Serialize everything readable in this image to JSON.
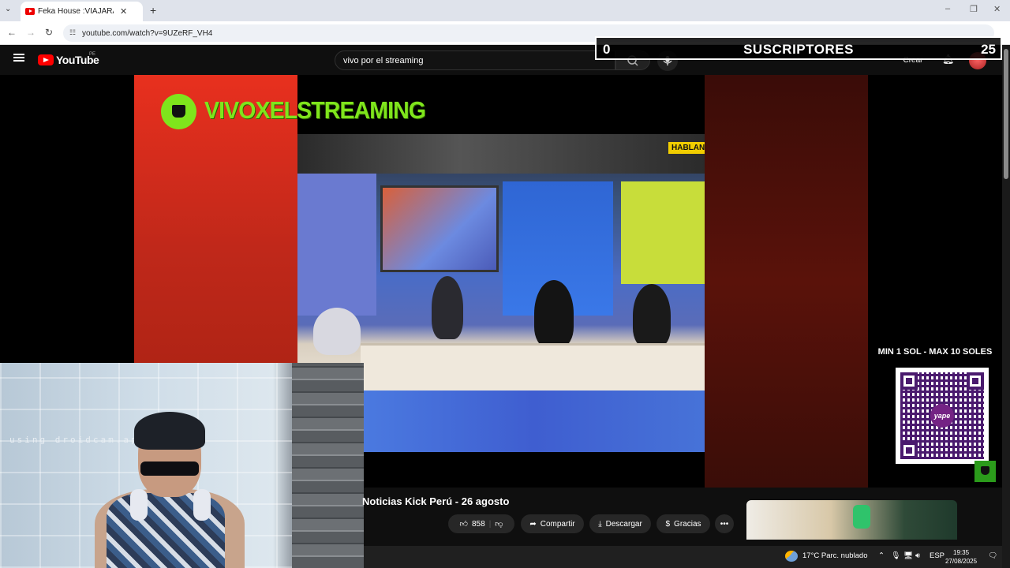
{
  "browser": {
    "tab_title": "Feka House :VIAJARÁ a",
    "url": "youtube.com/watch?v=9UZeRF_VH4",
    "new_tab_symbol": "+",
    "close_symbol": "✕",
    "menu_symbol": "⌄",
    "min_symbol": "–",
    "max_symbol": "❐",
    "winclose_symbol": "✕"
  },
  "youtube": {
    "wordmark": "YouTube",
    "country": "PE",
    "search_value": "vivo por el streaming",
    "create_label": "Crear"
  },
  "overlay": {
    "sub_left": "0",
    "sub_label": "SUSCRIPTORES",
    "sub_right": "25",
    "channel_name": "VIVOXELSTREAMING",
    "donation_label": "MIN 1 SOL - MAX 10 SOLES",
    "yape_text": "yape",
    "studio_sign": "HABLAN"
  },
  "webcam": {
    "watermark": "using droidcam.app"
  },
  "video": {
    "title": "Noticias Kick Perú - 26 agosto",
    "likes": "858",
    "share_label": "Compartir",
    "download_label": "Descargar",
    "thanks_label": "Gracias",
    "more_label": "•••"
  },
  "taskbar": {
    "weather": "17°C  Parc. nublado",
    "lang": "ESP",
    "time": "19:35",
    "date": "27/08/2025"
  },
  "colors": {
    "yt_red": "#ff0000",
    "brand_green": "#7fe51c",
    "yape_purple": "#742384"
  }
}
